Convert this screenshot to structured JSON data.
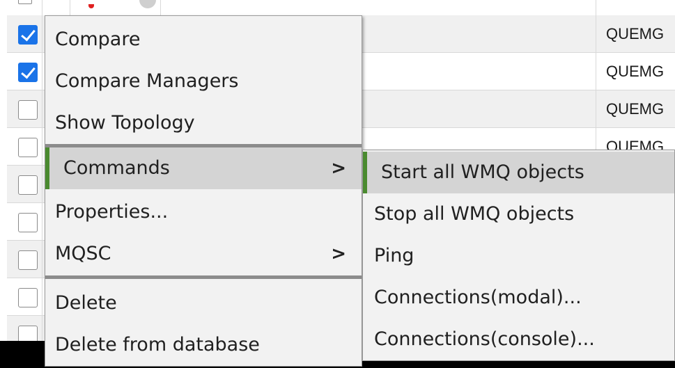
{
  "colors": {
    "checkbox_checked": "#1a73e8",
    "menu_background": "#f2f2f2",
    "highlight_background": "#d4d4d4",
    "highlight_accent": "#4a8a2f",
    "separator": "#8c8c8c"
  },
  "table": {
    "rows": [
      {
        "checked": true,
        "name": "QUEMG"
      },
      {
        "checked": true,
        "name": "QUEMG"
      },
      {
        "checked": false,
        "name": "QUEMG"
      },
      {
        "checked": false,
        "name": "QUEMG"
      },
      {
        "checked": false,
        "name": ""
      },
      {
        "checked": false,
        "name": ""
      },
      {
        "checked": false,
        "name": ""
      },
      {
        "checked": false,
        "name": ""
      }
    ]
  },
  "context_menu": {
    "compare": "Compare",
    "compare_managers": "Compare Managers",
    "show_topology": "Show Topology",
    "commands": "Commands",
    "properties": "Properties...",
    "mqsc": "MQSC",
    "delete": "Delete",
    "delete_from_database": "Delete from database",
    "submenu_arrow_icon": "chevron-right-icon",
    "highlighted_item": "Commands"
  },
  "commands_submenu": {
    "start_all": "Start all WMQ objects",
    "stop_all": "Stop all WMQ objects",
    "ping": "Ping",
    "connections_modal": "Connections(modal)...",
    "connections_console": "Connections(console)...",
    "highlighted_item": "Start all WMQ objects"
  }
}
